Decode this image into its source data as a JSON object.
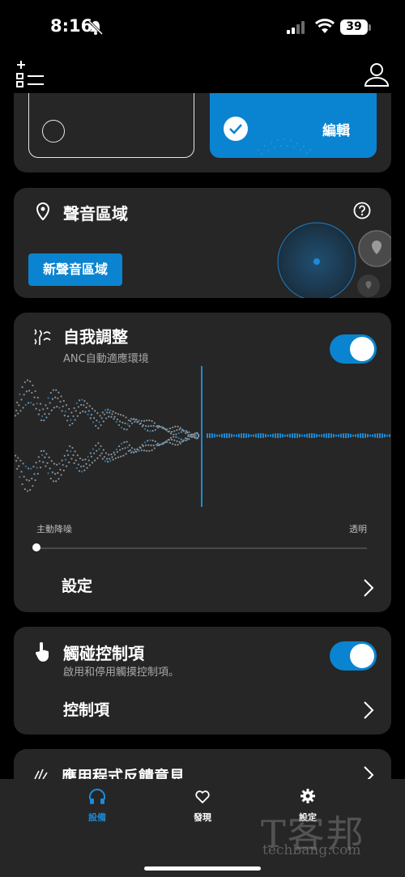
{
  "status_bar": {
    "time": "8:16",
    "battery": "39"
  },
  "top_card": {
    "edit_label": "編輯"
  },
  "sound_zone": {
    "title": "聲音區域",
    "new_button": "新聲音區域"
  },
  "self_adjust": {
    "title": "自我調整",
    "subtitle": "ANC自動適應環境",
    "toggle_on": true,
    "slider_left_label": "主動降噪",
    "slider_right_label": "透明",
    "slider_value_percent": 0,
    "settings_label": "設定"
  },
  "touch_controls": {
    "title": "觸碰控制項",
    "subtitle": "啟用和停用觸摸控制項。",
    "toggle_on": true,
    "controls_label": "控制項"
  },
  "feedback": {
    "title": "應用程式反饋意見"
  },
  "tab_bar": {
    "tabs": [
      {
        "label": "設備",
        "icon": "headphones-icon",
        "active": true
      },
      {
        "label": "發現",
        "icon": "heart-icon",
        "active": false
      },
      {
        "label": "設定",
        "icon": "gear-icon",
        "active": false
      }
    ]
  },
  "watermark": {
    "brand": "T客邦",
    "site": "techbang.com"
  },
  "colors": {
    "accent": "#0a84d0",
    "card": "#262626",
    "background": "#000000"
  }
}
